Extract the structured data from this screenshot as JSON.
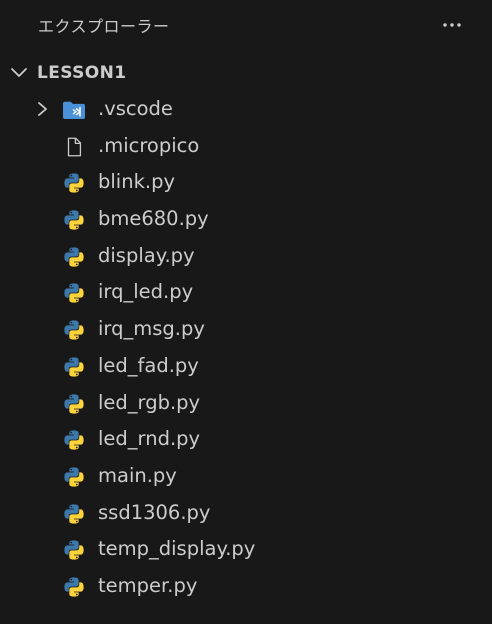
{
  "explorer": {
    "title": "エクスプローラー",
    "more_icon": "ellipsis-icon"
  },
  "folder": {
    "name": "LESSON1",
    "expanded": true,
    "chevron_icon": "chevron-down-icon"
  },
  "items": [
    {
      "label": ".vscode",
      "kind": "folder",
      "icon": "vscode-folder-icon",
      "expanded": false
    },
    {
      "label": ".micropico",
      "kind": "file",
      "icon": "file-icon"
    },
    {
      "label": "blink.py",
      "kind": "file",
      "icon": "python-icon"
    },
    {
      "label": "bme680.py",
      "kind": "file",
      "icon": "python-icon"
    },
    {
      "label": "display.py",
      "kind": "file",
      "icon": "python-icon"
    },
    {
      "label": "irq_led.py",
      "kind": "file",
      "icon": "python-icon"
    },
    {
      "label": "irq_msg.py",
      "kind": "file",
      "icon": "python-icon"
    },
    {
      "label": "led_fad.py",
      "kind": "file",
      "icon": "python-icon"
    },
    {
      "label": "led_rgb.py",
      "kind": "file",
      "icon": "python-icon"
    },
    {
      "label": "led_rnd.py",
      "kind": "file",
      "icon": "python-icon"
    },
    {
      "label": "main.py",
      "kind": "file",
      "icon": "python-icon"
    },
    {
      "label": "ssd1306.py",
      "kind": "file",
      "icon": "python-icon"
    },
    {
      "label": "temp_display.py",
      "kind": "file",
      "icon": "python-icon"
    },
    {
      "label": "temper.py",
      "kind": "file",
      "icon": "python-icon"
    }
  ],
  "colors": {
    "background": "#181818",
    "text": "#cccccc",
    "python_blue": "#3c78aa",
    "python_yellow": "#ffd43b",
    "vscode_folder": "#4a90d9"
  }
}
